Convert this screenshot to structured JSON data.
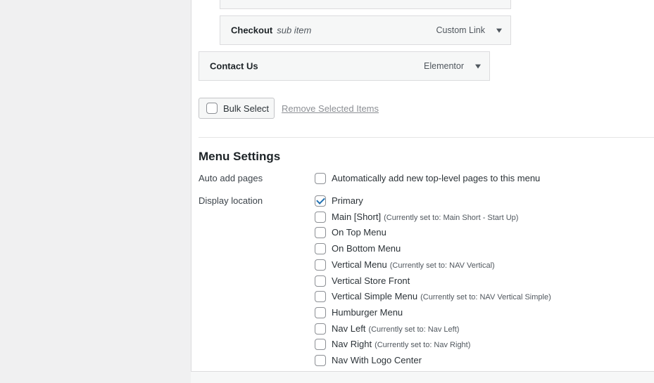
{
  "menu_items": {
    "checkout": {
      "title": "Checkout",
      "sub": "sub item",
      "type": "Custom Link"
    },
    "contact": {
      "title": "Contact Us",
      "type": "Elementor"
    }
  },
  "bulk": {
    "button_label": "Bulk Select",
    "remove_label": "Remove Selected Items"
  },
  "settings": {
    "heading": "Menu Settings",
    "auto_add": {
      "label": "Auto add pages",
      "option": "Automatically add new top-level pages to this menu"
    },
    "display_location": {
      "label": "Display location",
      "options": [
        {
          "label": "Primary",
          "note": "",
          "checked": true
        },
        {
          "label": "Main [Short]",
          "note": "(Currently set to: Main Short - Start Up)",
          "checked": false
        },
        {
          "label": "On Top Menu",
          "note": "",
          "checked": false
        },
        {
          "label": "On Bottom Menu",
          "note": "",
          "checked": false
        },
        {
          "label": "Vertical Menu",
          "note": "(Currently set to: NAV Vertical)",
          "checked": false
        },
        {
          "label": "Vertical Store Front",
          "note": "",
          "checked": false
        },
        {
          "label": "Vertical Simple Menu",
          "note": "(Currently set to: NAV Vertical Simple)",
          "checked": false
        },
        {
          "label": "Humburger Menu",
          "note": "",
          "checked": false
        },
        {
          "label": "Nav Left",
          "note": "(Currently set to: Nav Left)",
          "checked": false
        },
        {
          "label": "Nav Right",
          "note": "(Currently set to: Nav Right)",
          "checked": false
        },
        {
          "label": "Nav With Logo Center",
          "note": "",
          "checked": false
        }
      ]
    }
  }
}
